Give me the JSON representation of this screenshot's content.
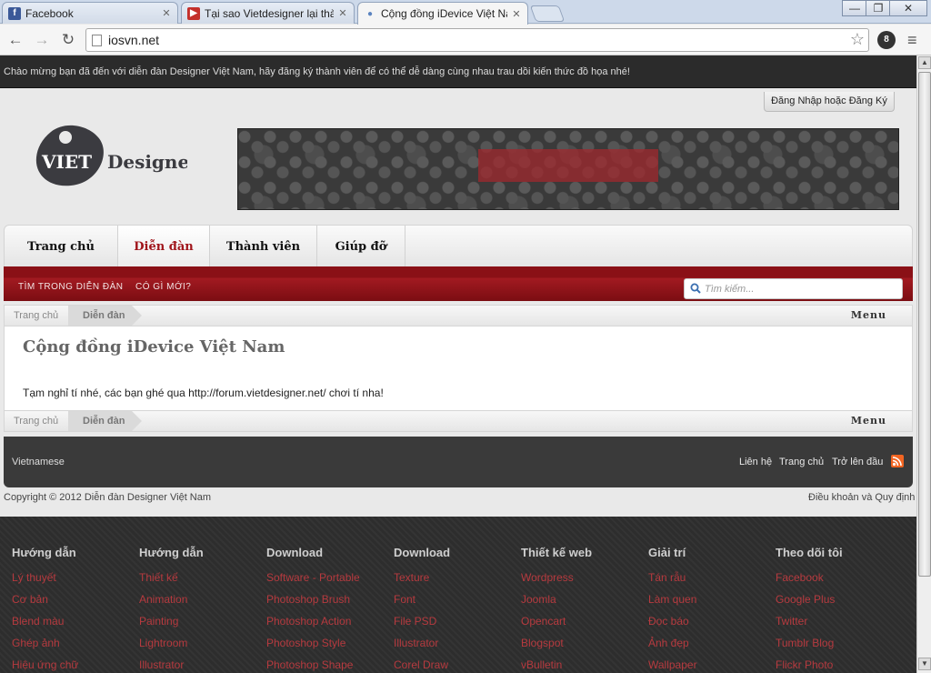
{
  "browser": {
    "tabs": [
      {
        "title": "Facebook",
        "icon": "facebook-icon"
      },
      {
        "title": "Tại sao Vietdesigner lại thành",
        "icon": "youtube-icon"
      },
      {
        "title": "Cộng đồng iDevice Việt Nam",
        "icon": "apple-icon"
      }
    ],
    "url": "iosvn.net",
    "window_controls": {
      "minimize": "—",
      "maximize": "❐",
      "close": "✕"
    },
    "extension_badge": "8"
  },
  "site": {
    "welcome": "Chào mừng bạn đã đến với diễn đàn Designer Việt Nam, hãy đăng ký thành viên để có thể dễ dàng cùng nhau trau dồi kiến thức đồ họa nhé!",
    "login_link": "Đăng Nhập hoặc Đăng Ký",
    "logo": {
      "left": "VIET",
      "right": "Designer"
    },
    "nav_tabs": [
      "Trang chủ",
      "Diễn đàn",
      "Thành viên",
      "Giúp đỡ"
    ],
    "sub_nav": [
      "TÌM TRONG DIỄN ĐÀN",
      "CÓ GÌ MỚI?"
    ],
    "search_placeholder": "Tìm kiếm...",
    "breadcrumb": {
      "home": "Trang chủ",
      "current": "Diễn đàn",
      "menu": "Menu"
    },
    "page_title": "Cộng đồng iDevice Việt Nam",
    "notice": "Tạm nghỉ tí nhé, các bạn ghé qua http://forum.vietdesigner.net/ chơi tí nha!",
    "footer": {
      "language": "Vietnamese",
      "links": [
        "Liên hệ",
        "Trang chủ",
        "Trở lên đầu"
      ],
      "copyright": "Copyright © 2012 Diễn đàn Designer Việt Nam",
      "terms": "Điều khoản và Quy định"
    },
    "footer_columns": [
      {
        "heading": "Hướng dẫn",
        "links": [
          "Lý thuyết",
          "Cơ bản",
          "Blend màu",
          "Ghép ảnh",
          "Hiệu ứng chữ"
        ]
      },
      {
        "heading": "Hướng dẫn",
        "links": [
          "Thiết kế",
          "Animation",
          "Painting",
          "Lightroom",
          "Illustrator"
        ]
      },
      {
        "heading": "Download",
        "links": [
          "Software - Portable",
          "Photoshop Brush",
          "Photoshop Action",
          "Photoshop Style",
          "Photoshop Shape"
        ]
      },
      {
        "heading": "Download",
        "links": [
          "Texture",
          "Font",
          "File PSD",
          "Illustrator",
          "Corel Draw"
        ]
      },
      {
        "heading": "Thiết kế web",
        "links": [
          "Wordpress",
          "Joomla",
          "Opencart",
          "Blogspot",
          "vBulletin"
        ]
      },
      {
        "heading": "Giải trí",
        "links": [
          "Tán rẫu",
          "Làm quen",
          "Đọc báo",
          "Ảnh đẹp",
          "Wallpaper"
        ]
      },
      {
        "heading": "Theo dõi tôi",
        "links": [
          "Facebook",
          "Google Plus",
          "Twitter",
          "Tumblr Blog",
          "Flickr Photo"
        ]
      }
    ],
    "colors": {
      "accent": "#a0151b",
      "link": "#b63a3f",
      "dark": "#2d2d2d"
    }
  }
}
